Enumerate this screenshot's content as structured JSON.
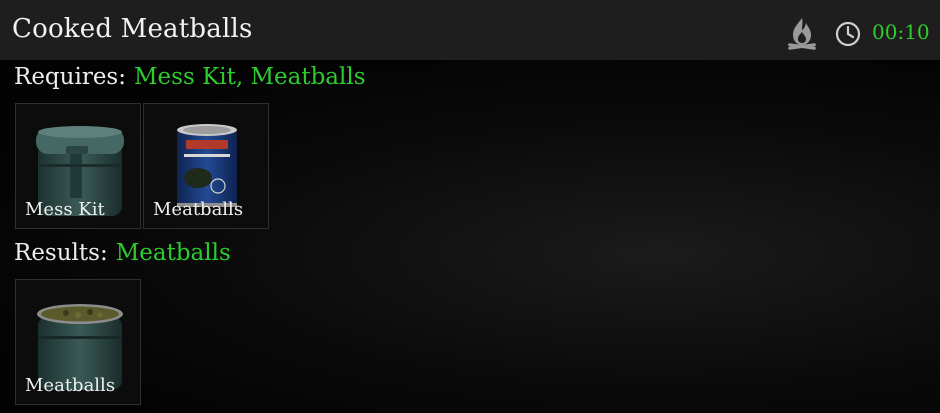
{
  "header": {
    "title": "Cooked Meatballs",
    "time": "00:10",
    "icons": [
      "campfire-icon",
      "clock-icon"
    ]
  },
  "requires": {
    "label": "Requires:",
    "value": "Mess Kit, Meatballs",
    "items": [
      {
        "name": "Mess Kit",
        "icon": "mess-kit-icon"
      },
      {
        "name": "Meatballs",
        "icon": "meatballs-can-icon"
      }
    ]
  },
  "results": {
    "label": "Results:",
    "value": "Meatballs",
    "items": [
      {
        "name": "Meatballs",
        "icon": "cooked-meatballs-icon"
      }
    ]
  },
  "colors": {
    "accent_green": "#2fcc2f",
    "header_bg": "#1e1e1e",
    "text": "#ededed"
  }
}
